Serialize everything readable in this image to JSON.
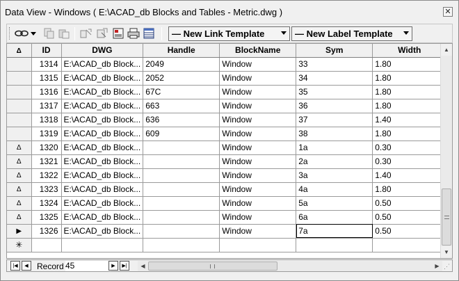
{
  "window": {
    "title": "Data View - Windows ( E:\\ACAD_db Blocks and Tables - Metric.dwg )",
    "close_glyph": "✕"
  },
  "toolbar": {
    "link_template": "— New Link Template",
    "label_template": "— New Label Template",
    "icons": [
      "link-icon",
      "dropdown-icon",
      "copy-icon",
      "paste-icon",
      "link-objects-icon",
      "link-refresh-icon",
      "query-icon",
      "print-icon",
      "grid-icon"
    ]
  },
  "grid": {
    "sort_glyph": "Δ",
    "columns": [
      "ID",
      "DWG",
      "Handle",
      "BlockName",
      "Sym",
      "Width"
    ],
    "rows": [
      {
        "marker": "",
        "id": "1314",
        "dwg": "E:\\ACAD_db Block...",
        "handle": "2049",
        "block": "Window",
        "sym": "33",
        "width": "1.80"
      },
      {
        "marker": "",
        "id": "1315",
        "dwg": "E:\\ACAD_db Block...",
        "handle": "2052",
        "block": "Window",
        "sym": "34",
        "width": "1.80"
      },
      {
        "marker": "",
        "id": "1316",
        "dwg": "E:\\ACAD_db Block...",
        "handle": "67C",
        "block": "Window",
        "sym": "35",
        "width": "1.80"
      },
      {
        "marker": "",
        "id": "1317",
        "dwg": "E:\\ACAD_db Block...",
        "handle": "663",
        "block": "Window",
        "sym": "36",
        "width": "1.80"
      },
      {
        "marker": "",
        "id": "1318",
        "dwg": "E:\\ACAD_db Block...",
        "handle": "636",
        "block": "Window",
        "sym": "37",
        "width": "1.40"
      },
      {
        "marker": "",
        "id": "1319",
        "dwg": "E:\\ACAD_db Block...",
        "handle": "609",
        "block": "Window",
        "sym": "38",
        "width": "1.80"
      },
      {
        "marker": "Δ",
        "id": "1320",
        "dwg": "E:\\ACAD_db Block...",
        "handle": "",
        "block": "Window",
        "sym": "1a",
        "width": "0.30"
      },
      {
        "marker": "Δ",
        "id": "1321",
        "dwg": "E:\\ACAD_db Block...",
        "handle": "",
        "block": "Window",
        "sym": "2a",
        "width": "0.30"
      },
      {
        "marker": "Δ",
        "id": "1322",
        "dwg": "E:\\ACAD_db Block...",
        "handle": "",
        "block": "Window",
        "sym": "3a",
        "width": "1.40"
      },
      {
        "marker": "Δ",
        "id": "1323",
        "dwg": "E:\\ACAD_db Block...",
        "handle": "",
        "block": "Window",
        "sym": "4a",
        "width": "1.80"
      },
      {
        "marker": "Δ",
        "id": "1324",
        "dwg": "E:\\ACAD_db Block...",
        "handle": "",
        "block": "Window",
        "sym": "5a",
        "width": "0.50"
      },
      {
        "marker": "Δ",
        "id": "1325",
        "dwg": "E:\\ACAD_db Block...",
        "handle": "",
        "block": "Window",
        "sym": "6a",
        "width": "0.50"
      },
      {
        "marker": "▶",
        "id": "1326",
        "dwg": "E:\\ACAD_db Block...",
        "handle": "",
        "block": "Window",
        "sym": "7a",
        "width": "0.50"
      }
    ],
    "new_row_marker": "✳"
  },
  "navigation": {
    "record_label": "Record",
    "record_value": "45"
  }
}
